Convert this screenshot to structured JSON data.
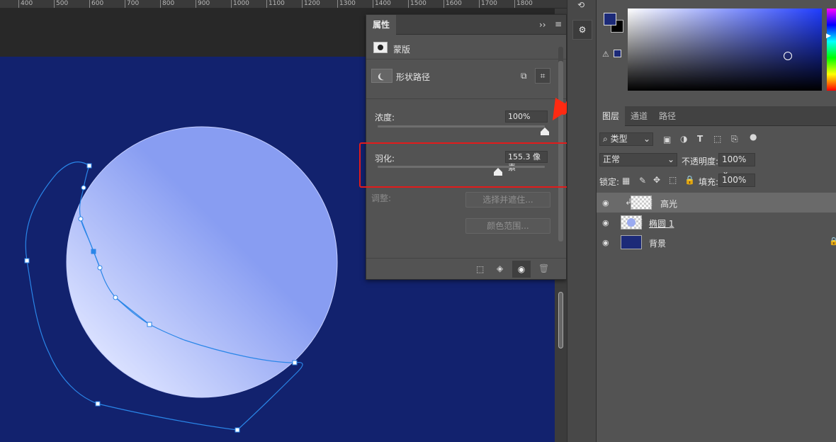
{
  "ruler": {
    "labels": [
      "400",
      "500",
      "600",
      "700",
      "800",
      "900",
      "1000",
      "1100",
      "1200",
      "1300",
      "1400",
      "1500",
      "1600",
      "1700",
      "1800"
    ]
  },
  "properties": {
    "tab": "属性",
    "mask_label": "蒙版",
    "shape_path_label": "形状路径",
    "density_label": "浓度:",
    "density_value": "100%",
    "density_level": 1.0,
    "feather_label": "羽化:",
    "feather_value": "155.3 像素",
    "feather_level": 0.72,
    "adjust_label": "调整:",
    "select_and_mask": "选择并遮住...",
    "color_range": "颜色范围..."
  },
  "colors": {
    "foreground": "#1c2a78",
    "background": "#000000",
    "canvas": "#12226e",
    "annotation": "#e21b1b"
  },
  "layers": {
    "tabs": [
      "图层",
      "通道",
      "路径"
    ],
    "filter_kind": "类型",
    "blend_mode": "正常",
    "opacity_label": "不透明度:",
    "opacity_value": "100%",
    "lock_label": "锁定:",
    "fill_label": "填充:",
    "fill_value": "100%",
    "items": [
      {
        "name": "高光",
        "selected": true
      },
      {
        "name": "椭圆 1",
        "selected": false
      },
      {
        "name": "背景",
        "selected": false
      }
    ]
  }
}
